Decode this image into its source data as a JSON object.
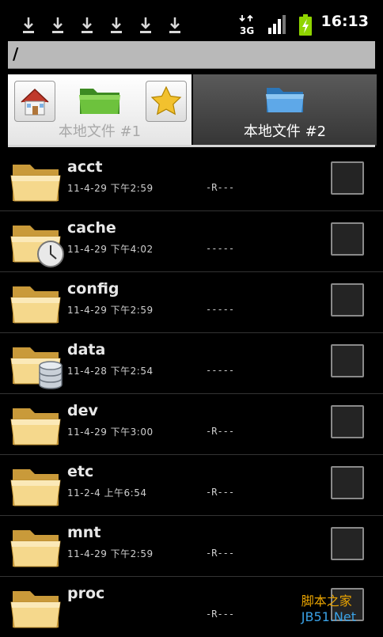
{
  "status_bar": {
    "download_icons": [
      "download-icon",
      "download-icon",
      "download-icon",
      "download-icon",
      "download-icon",
      "download-icon"
    ],
    "network_label": "3G",
    "time": "16:13",
    "colors": {
      "battery": "#8fd400"
    }
  },
  "path": {
    "current": "/"
  },
  "tabs": [
    {
      "label": "本地文件 #1",
      "active": false
    },
    {
      "label": "本地文件 #2",
      "active": true
    }
  ],
  "files": [
    {
      "name": "acct",
      "date": "11-4-29  下午2:59",
      "perm": "-R---",
      "overlay": ""
    },
    {
      "name": "cache",
      "date": "11-4-29  下午4:02",
      "perm": "-----",
      "overlay": "clock-icon"
    },
    {
      "name": "config",
      "date": "11-4-29  下午2:59",
      "perm": "-----",
      "overlay": ""
    },
    {
      "name": "data",
      "date": "11-4-28  下午2:54",
      "perm": "-----",
      "overlay": "database-icon"
    },
    {
      "name": "dev",
      "date": "11-4-29  下午3:00",
      "perm": "-R---",
      "overlay": ""
    },
    {
      "name": "etc",
      "date": "11-2-4  上午6:54",
      "perm": "-R---",
      "overlay": ""
    },
    {
      "name": "mnt",
      "date": "11-4-29  下午2:59",
      "perm": "-R---",
      "overlay": ""
    },
    {
      "name": "proc",
      "date": "",
      "perm": "-R---",
      "overlay": ""
    }
  ],
  "watermark": {
    "line1": "脚本之家",
    "line2": "JB51.Net"
  }
}
